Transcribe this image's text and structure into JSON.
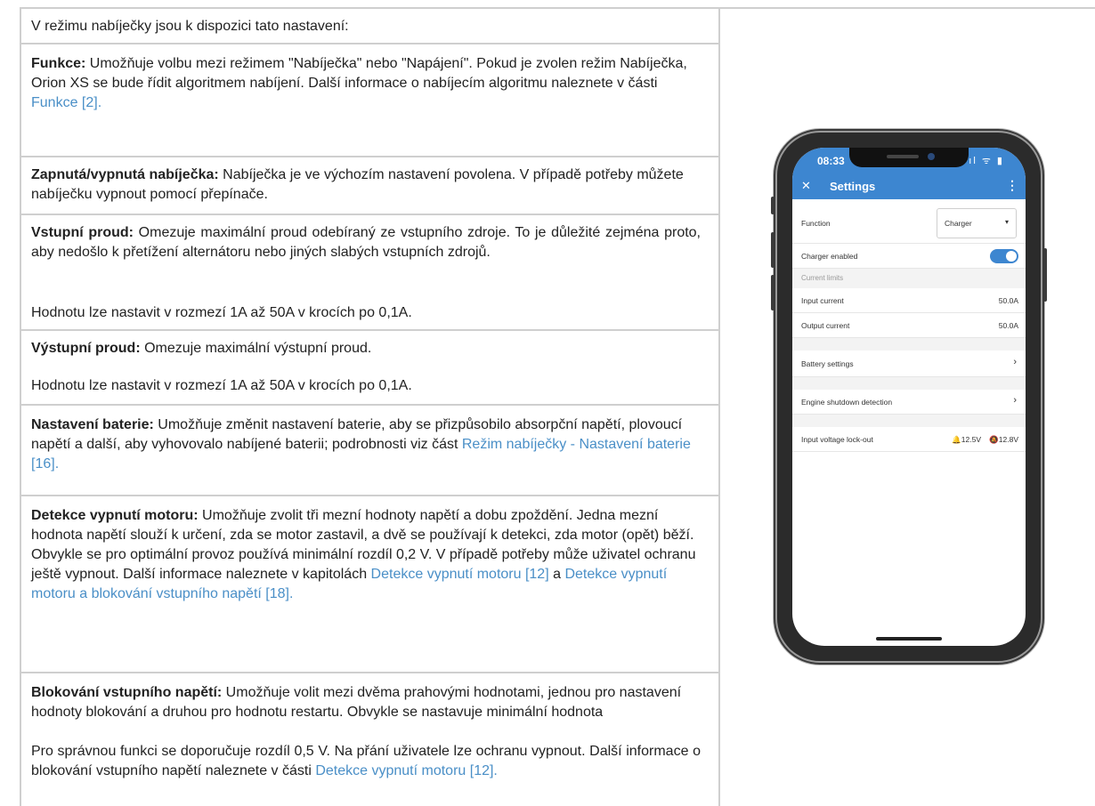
{
  "document": {
    "intro": "V režimu nabíječky jsou k dispozici tato nastavení:",
    "funkce": {
      "term": "Funkce:",
      "text": " Umožňuje volbu mezi režimem \"Nabíječka\" nebo \"Napájení\". Pokud je zvolen režim Nabíječka, Orion XS se bude řídit algoritmem nabíjení. Další informace o nabíjecím algoritmu naleznete v části ",
      "link": "Funkce [2]."
    },
    "enable": {
      "term": "Zapnutá/vypnutá nabíječka:",
      "text": " Nabíječka je ve výchozím nastavení povolena. V případě potřeby můžete nabíječku vypnout pomocí přepínače."
    },
    "input_current": {
      "term": "Vstupní proud:",
      "text": " Omezuje maximální proud odebíraný ze vstupního zdroje. To je důležité zejména proto, aby nedošlo k přetížení alternátoru nebo jiných slabých vstupních zdrojů.",
      "range": "Hodnotu lze nastavit v rozmezí 1A až 50A v krocích po 0,1A."
    },
    "output_current": {
      "term": "Výstupní proud:",
      "text": " Omezuje maximální výstupní proud.",
      "range": "Hodnotu lze nastavit v rozmezí 1A až 50A v krocích po 0,1A."
    },
    "battery": {
      "term": "Nastavení baterie:",
      "text": " Umožňuje změnit nastavení baterie, aby se přizpůsobilo absorpční napětí, plovoucí napětí a další, aby vyhovovalo nabíjené baterii; podrobnosti viz část ",
      "link": "Režim nabíječky - Nastavení baterie [16]."
    },
    "engine": {
      "term": "Detekce vypnutí motoru:",
      "text": " Umožňuje zvolit tři mezní hodnoty napětí a dobu zpoždění. Jedna mezní hodnota napětí slouží k určení, zda se motor zastavil, a dvě se používají k detekci, zda motor (opět) běží. Obvykle se pro optimální provoz používá minimální rozdíl 0,2 V. V případě potřeby může uživatel ochranu ještě vypnout. Další informace naleznete v kapitolách ",
      "link1": "Detekce vypnutí motoru [12]",
      "mid": " a ",
      "link2": "Detekce vypnutí motoru a blokování vstupního napětí [18]."
    },
    "lockout": {
      "term": "Blokování vstupního napětí:",
      "text": " Umožňuje volit mezi dvěma prahovými hodnotami, jednou pro nastavení hodnoty blokování a druhou pro hodnotu restartu. Obvykle se nastavuje minimální hodnota",
      "text2": "Pro správnou funkci se doporučuje rozdíl 0,5 V. Na přání uživatele lze ochranu vypnout. Další informace o blokování vstupního napětí naleznete v části ",
      "link": "Detekce vypnutí motoru [12]."
    }
  },
  "phone": {
    "time": "08:33",
    "status_icons": "ıl ᯤ ▮",
    "appbar": {
      "close": "✕",
      "title": "Settings",
      "menu": "⋮"
    },
    "function": {
      "label": "Function",
      "value": "Charger",
      "arrow": "▾"
    },
    "charger_enabled": {
      "label": "Charger enabled",
      "on": true
    },
    "current_limits": "Current limits",
    "input_current": {
      "label": "Input current",
      "value": "50.0A"
    },
    "output_current": {
      "label": "Output current",
      "value": "50.0A"
    },
    "battery_settings": {
      "label": "Battery settings",
      "chevron": "›"
    },
    "engine_shutdown": {
      "label": "Engine shutdown detection",
      "chevron": "›"
    },
    "lockout": {
      "label": "Input voltage lock-out",
      "v1": "🔔12.5V",
      "v2": "🔕12.8V"
    }
  },
  "colors": {
    "link": "#4a8fc7",
    "app_blue": "#3d86d0",
    "border": "#cfcfcf"
  }
}
